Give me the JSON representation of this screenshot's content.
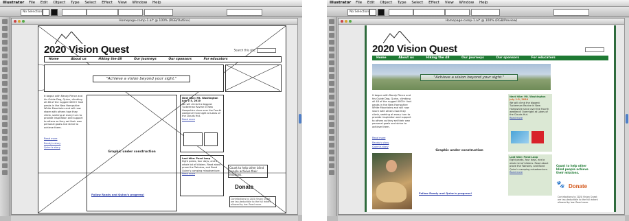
{
  "menu": {
    "app": "Illustrator",
    "items": [
      "File",
      "Edit",
      "Object",
      "Type",
      "Select",
      "Effect",
      "View",
      "Window",
      "Help"
    ]
  },
  "control_bar": {
    "selection": "No Selection"
  },
  "left_window": {
    "doc_title": "Homepage-comp-1.ai* @ 100% (RGB/Outline)"
  },
  "right_window": {
    "doc_title": "Homepage-comp-1.ai* @ 100% (RGB/Preview)"
  },
  "site": {
    "logo": "2020 Vision Quest",
    "search_label": "Search this site:",
    "nav": [
      "Home",
      "About us",
      "Hiking the 48",
      "Our journeys",
      "Our sponsors",
      "For educators"
    ],
    "tagline": "\"Achieve a vision beyond your sight.\"",
    "intro": "It began with Randy Pierce and his Guide Dog, Quinn, climbing all 48 of the rugged 4000+ foot peaks in the New Hampshire White Mountains and will now share with others how they climb, seeking at every turn to provide inspiration and support to others as they set their own personal goals and strive to achieve them.",
    "read_more": "Read more",
    "links": [
      "Randy's story",
      "Quinn's story"
    ],
    "graphic_msg": "Graphic under construction",
    "follow_link": "Follow Randy and Quinn's progress!",
    "next_hike": {
      "title": "Next hike: Mt. Washington",
      "date": "July 1-3, 2010",
      "body": "We will climb the biggest Tuckerman Ravine in New Hampshire since over the Fourth weekend! Overnight at Lakes of the Clouds Hut.",
      "read_more": "Read more"
    },
    "last_hike": {
      "title": "Last hike: Pond Loop",
      "body": "Eight peaks, four days, and a whole lot of blisters. Read about prove the Twinsies, and Bond Quinn's camping misadventure.",
      "read_more": "Read more"
    },
    "help_text": "Count to help other blind people achieve their missions.",
    "donate": "Donate",
    "contrib": "Contributions to 2020 Vision Quest are tax-deductible to the full extent allowed by law. Read more."
  }
}
